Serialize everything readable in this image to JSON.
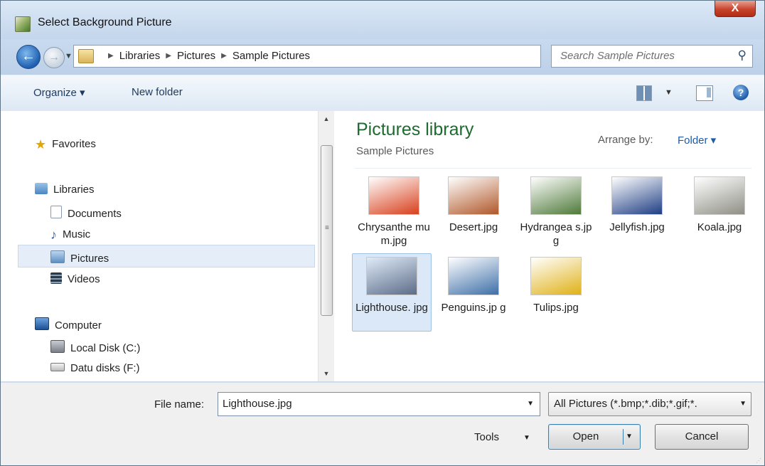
{
  "window": {
    "title": "Select Background Picture",
    "close_label": "X"
  },
  "nav": {
    "back_glyph": "←",
    "forward_glyph": "→",
    "recent_glyph": "▼"
  },
  "address": {
    "crumbs": [
      "Libraries",
      "Pictures",
      "Sample Pictures"
    ],
    "separator_glyph": "▶",
    "dropdown_glyph": "▼",
    "refresh_glyph": "↔"
  },
  "search": {
    "placeholder": "Search Sample Pictures",
    "icon": "search-icon",
    "glyph": "⚲"
  },
  "toolbar": {
    "organize": "Organize ▾",
    "new_folder": "New folder",
    "views_dd": "▼",
    "help_glyph": "?"
  },
  "sidebar": {
    "favorites": "Favorites",
    "libraries": "Libraries",
    "documents": "Documents",
    "music": "Music",
    "pictures": "Pictures",
    "videos": "Videos",
    "computer": "Computer",
    "local_disk": "Local Disk (C:)",
    "datu_disks": "Datu disks (F:)"
  },
  "scroll": {
    "up": "▲",
    "down": "▼",
    "grip": "≡"
  },
  "content": {
    "title": "Pictures library",
    "subtitle": "Sample Pictures",
    "arrange_label": "Arrange by:",
    "arrange_value": "Folder ▾",
    "files": [
      {
        "name": "Chrysanthe mum.jpg",
        "color": "#d8401c"
      },
      {
        "name": "Desert.jpg",
        "color": "#b0582a"
      },
      {
        "name": "Hydrangea s.jpg",
        "color": "#4f7a3a"
      },
      {
        "name": "Jellyfish.jpg",
        "color": "#1f3e84"
      },
      {
        "name": "Koala.jpg",
        "color": "#8f8f86"
      },
      {
        "name": "Lighthouse. jpg",
        "color": "#5c6c88",
        "selected": true
      },
      {
        "name": "Penguins.jp g",
        "color": "#3e6fa8"
      },
      {
        "name": "Tulips.jpg",
        "color": "#e0b118"
      }
    ]
  },
  "footer": {
    "file_name_label": "File name:",
    "file_name_value": "Lighthouse.jpg",
    "filter_value": "All Pictures (*.bmp;*.dib;*.gif;*.",
    "dd_glyph": "▼",
    "tools": "Tools",
    "open": "Open",
    "cancel": "Cancel",
    "grip": "⋰"
  },
  "colors": {
    "accent_green": "#1e6b30",
    "link_blue": "#1e5aa8",
    "close_red": "#c7432b"
  }
}
